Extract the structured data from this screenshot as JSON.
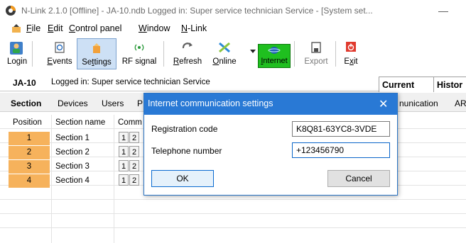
{
  "window": {
    "title": "N-Link 2.1.0 [Offline] - JA-10.ndb Logged in: Super service technician Service - [System set...",
    "minimize_glyph": "—"
  },
  "menu": {
    "items": [
      {
        "label": "File"
      },
      {
        "label": "Edit"
      },
      {
        "label": "Control panel"
      },
      {
        "label": "Window"
      },
      {
        "label": "N-Link"
      }
    ]
  },
  "toolbar": {
    "buttons": [
      {
        "label": "Login",
        "icon": "login-icon"
      },
      {
        "label": "Events",
        "icon": "events-icon"
      },
      {
        "label": "Settings",
        "icon": "settings-icon",
        "active": true
      },
      {
        "label": "RF signal",
        "icon": "rf-signal-icon"
      },
      {
        "label": "Refresh",
        "icon": "refresh-icon"
      },
      {
        "label": "Online",
        "icon": "online-icon"
      },
      {
        "label": "Internet",
        "icon": "internet-icon"
      },
      {
        "label": "Export",
        "icon": "export-icon"
      },
      {
        "label": "Exit",
        "icon": "exit-icon"
      }
    ],
    "colors": {
      "internet_bg": "#1fbf1f",
      "active_bg": "#cde0f5"
    }
  },
  "status": {
    "panel": "JA-10",
    "logged_in": "Logged in: Super service technician Service"
  },
  "view_tabs": {
    "current": "Current",
    "history": "Histor"
  },
  "tabs": [
    "Section",
    "Devices",
    "Users",
    "P",
    "nunication",
    "AR"
  ],
  "table": {
    "headers": {
      "position": "Position",
      "name": "Section name",
      "comm": "Comm"
    },
    "rows": [
      {
        "position": "1",
        "name": "Section 1"
      },
      {
        "position": "2",
        "name": "Section 2"
      },
      {
        "position": "3",
        "name": "Section 3"
      },
      {
        "position": "4",
        "name": "Section 4"
      }
    ],
    "box_labels": [
      "1",
      "2"
    ],
    "position_color": "#f6b25c"
  },
  "dialog": {
    "title": "Internet communication settings",
    "close_glyph": "✕",
    "registration_label": "Registration code",
    "registration_value": "K8Q81-63YC8-3VDE",
    "phone_label": "Telephone number",
    "phone_value": "+123456790",
    "ok_label": "OK",
    "cancel_label": "Cancel",
    "title_color": "#2979d5"
  }
}
